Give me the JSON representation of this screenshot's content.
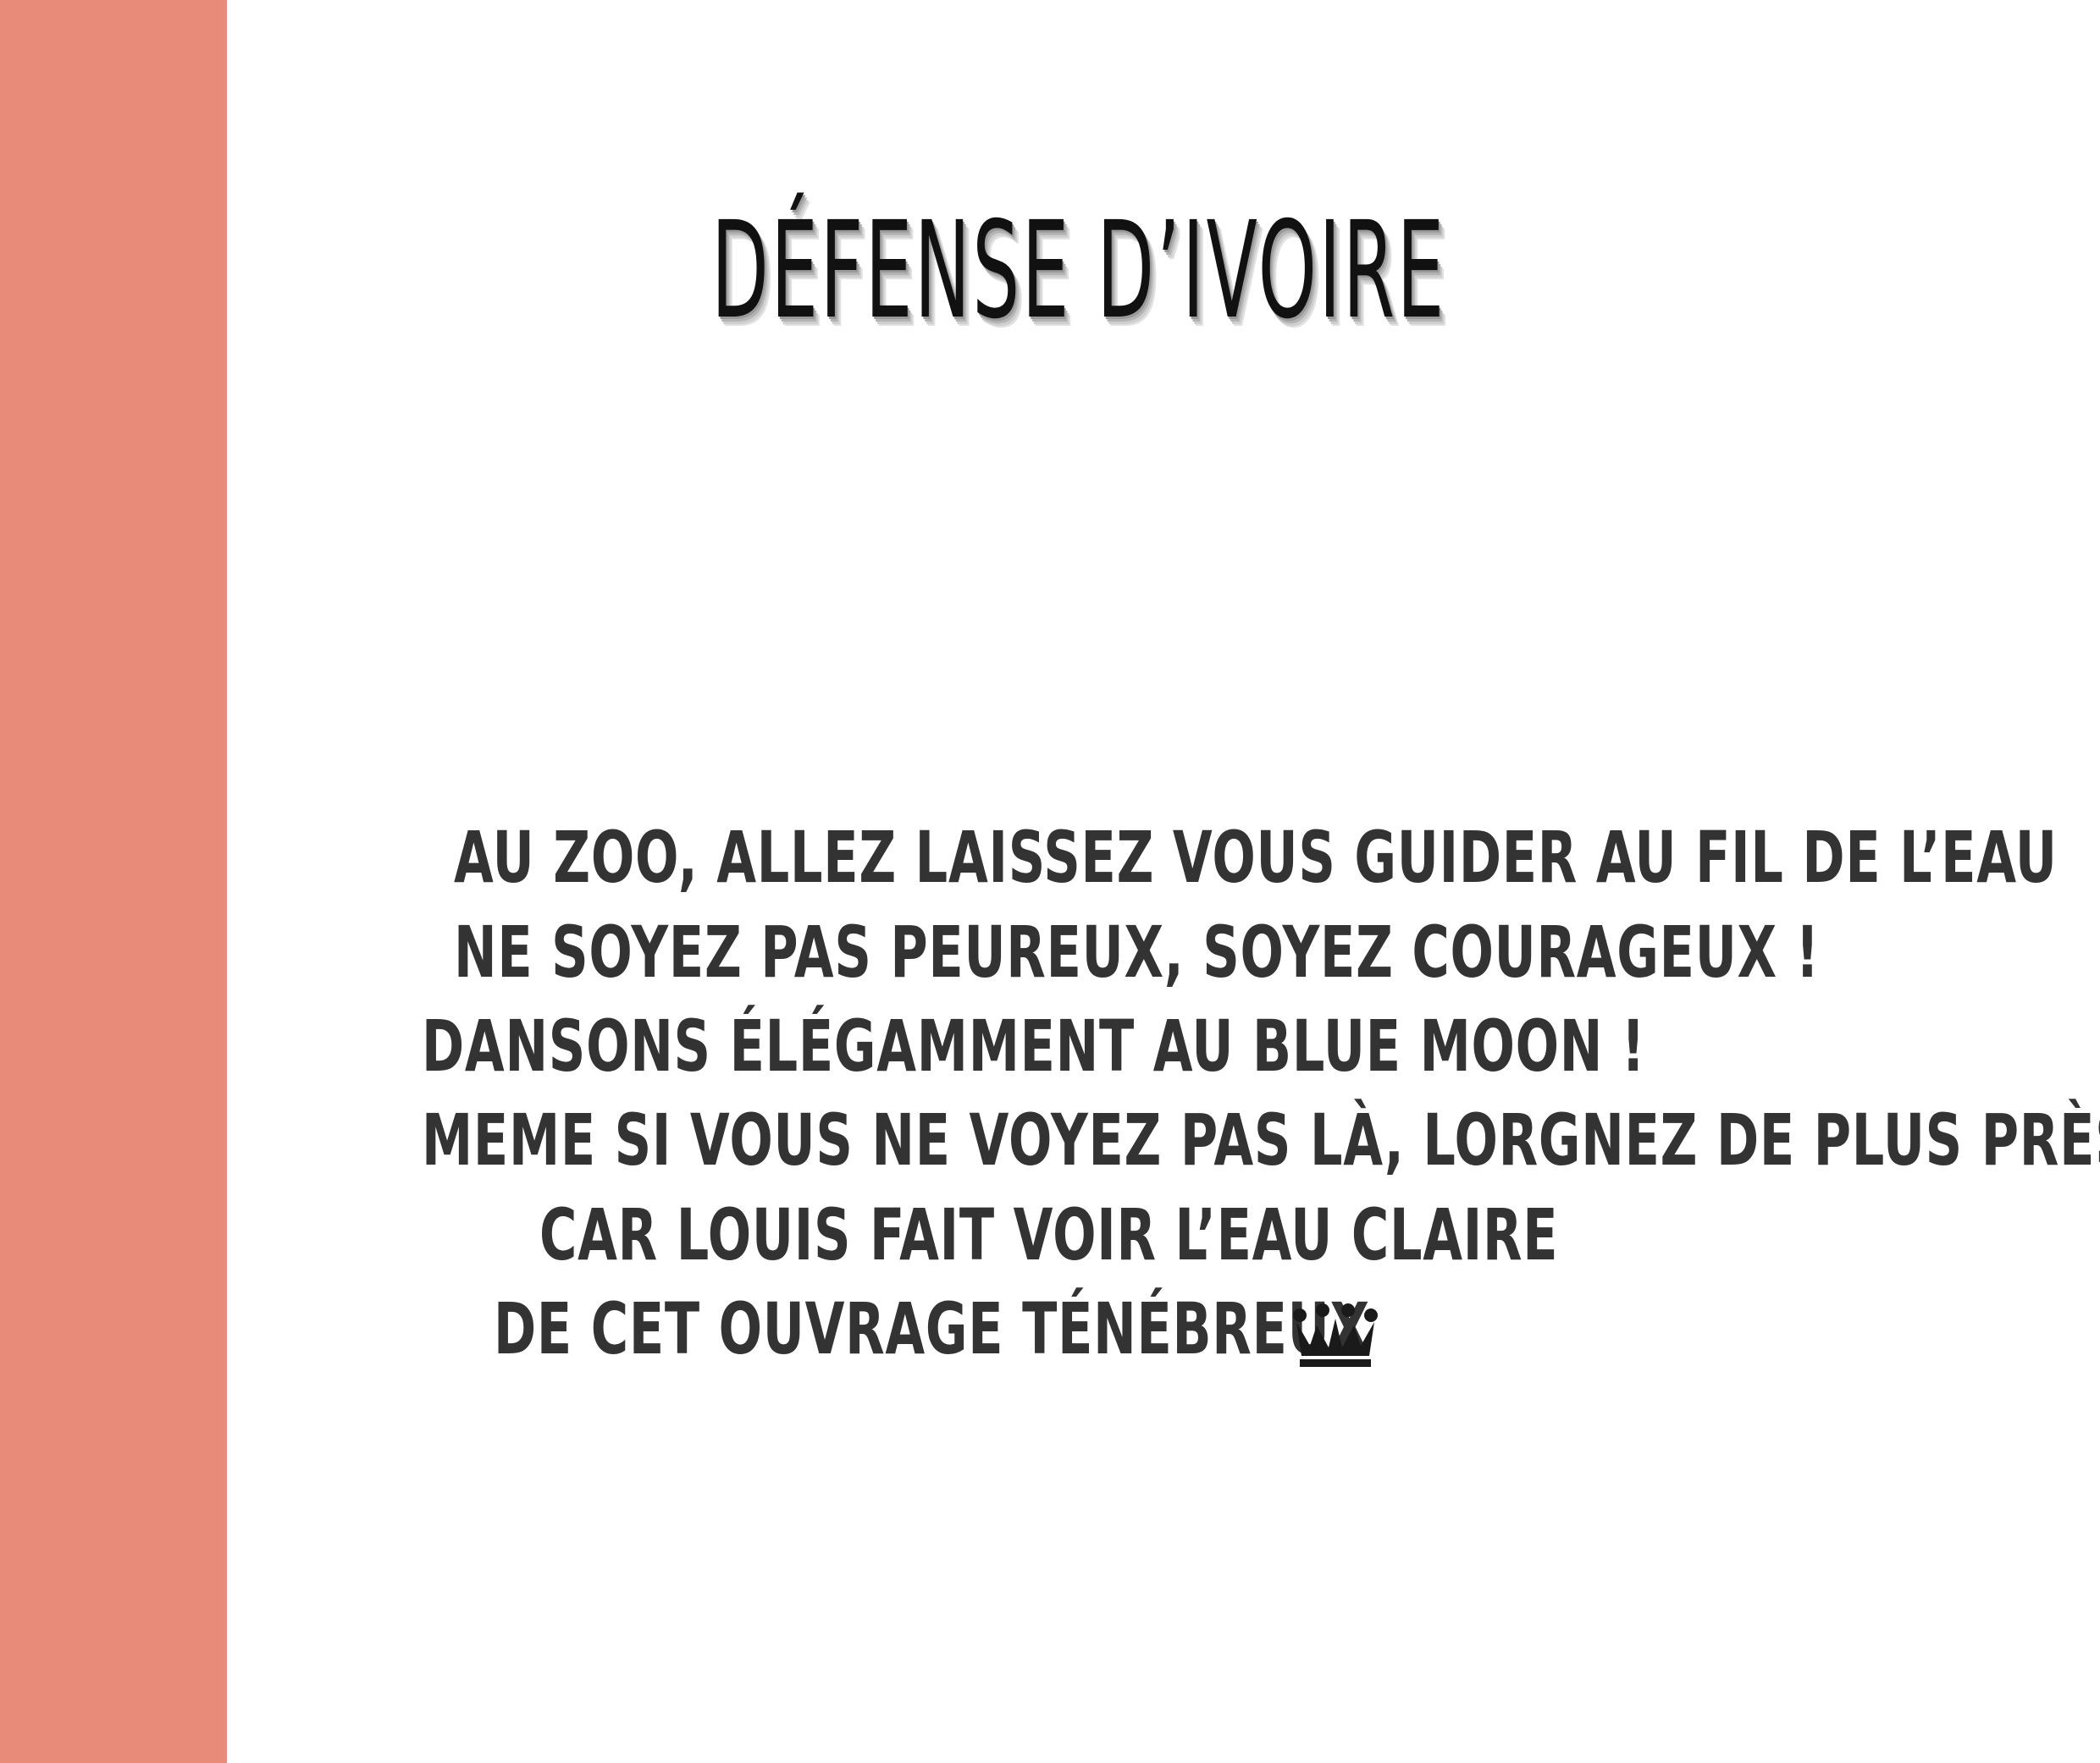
{
  "theme": {
    "side_band_color": "#E88B78",
    "text_color": "#333333",
    "title_color": "#111111"
  },
  "title": "DÉFENSE  D’IVOIRE",
  "lyrics": [
    "AU ZOO, ALLEZ LAISSEZ VOUS GUIDER AU FIL DE L’EAU",
    "NE SOYEZ PAS PEUREUX, SOYEZ COURAGEUX !",
    "DANSONS ÉLÉGAMMENT AU BLUE MOON !",
    "MEME SI VOUS NE VOYEZ PAS LÀ, LORGNEZ DE PLUS PRÈS",
    "CAR LOUIS FAIT VOIR L’EAU CLAIRE",
    "DE CET OUVRAGE TÉNÉBREUX"
  ],
  "icons": {
    "end_mark": "crown-icon"
  }
}
